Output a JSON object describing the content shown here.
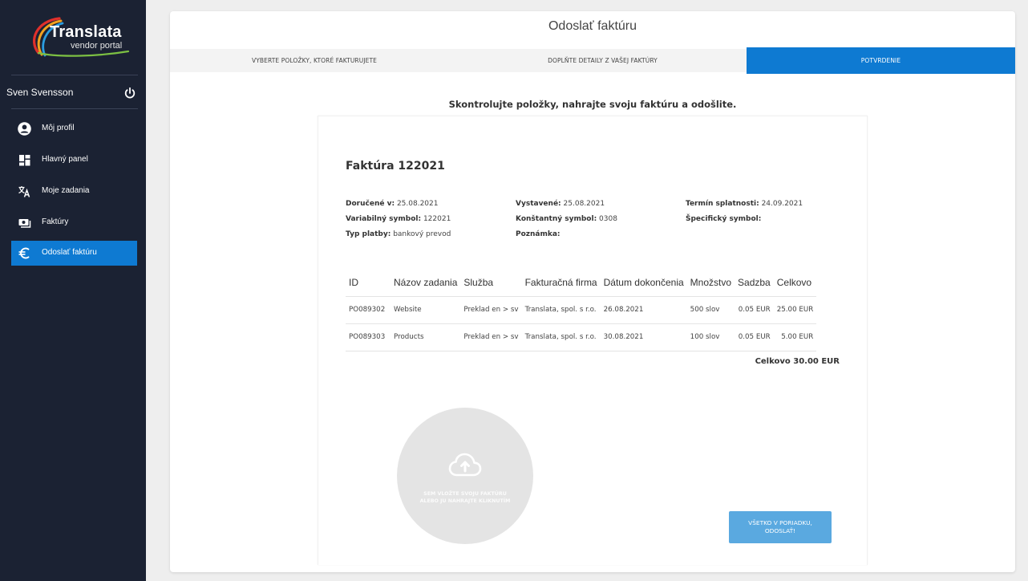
{
  "sidebar": {
    "logo": {
      "title": "Translata",
      "subtitle": "vendor portal"
    },
    "user": {
      "name": "Sven Svensson",
      "logout_icon": "power-icon"
    },
    "nav": [
      {
        "label": "Môj profil",
        "icon": "user-circle-icon",
        "active": false
      },
      {
        "label": "Hlavný panel",
        "icon": "dashboard-icon",
        "active": false
      },
      {
        "label": "Moje zadania",
        "icon": "translate-icon",
        "active": false
      },
      {
        "label": "Faktúry",
        "icon": "invoice-icon",
        "active": false
      },
      {
        "label": "Odoslať faktúru",
        "icon": "euro-icon",
        "active": true
      }
    ]
  },
  "page": {
    "title": "Odoslať faktúru",
    "steps": [
      {
        "label": "VYBERTE POLOŽKY, KTORÉ FAKTURUJETE",
        "active": false
      },
      {
        "label": "DOPLŇTE DETAILY Z VAŠEJ FAKTÚRY",
        "active": false
      },
      {
        "label": "POTVRDENIE",
        "active": true
      }
    ],
    "instruction": "Skontrolujte položky, nahrajte svoju faktúru a odošlite."
  },
  "invoice": {
    "title": "Faktúra 122021",
    "meta": {
      "received_label": "Doručené v:",
      "received": "25.08.2021",
      "issued_label": "Vystavené:",
      "issued": "25.08.2021",
      "due_label": "Termín splatnosti:",
      "due": "24.09.2021",
      "variable_label": "Variabilný symbol:",
      "variable": "122021",
      "constant_label": "Konštantný symbol:",
      "constant": "0308",
      "specific_label": "Špecifický symbol:",
      "specific": "",
      "payment_label": "Typ platby:",
      "payment": "bankový prevod",
      "note_label": "Poznámka:",
      "note": ""
    },
    "columns": [
      "ID",
      "Názov zadania",
      "Služba",
      "Fakturačná firma",
      "Dátum dokončenia",
      "Množstvo",
      "Sadzba",
      "Celkovo"
    ],
    "rows": [
      [
        "PO089302",
        "Website",
        "Preklad en > sv",
        "Translata, spol. s r.o.",
        "26.08.2021",
        "500 slov",
        "0.05 EUR",
        "25.00 EUR"
      ],
      [
        "PO089303",
        "Products",
        "Preklad en > sv",
        "Translata, spol. s r.o.",
        "30.08.2021",
        "100 slov",
        "0.05 EUR",
        "5.00 EUR"
      ]
    ],
    "total": "Celkovo 30.00 EUR"
  },
  "upload": {
    "icon": "cloud-upload-icon",
    "line1": "SEM VLOŽTE SVOJU FAKTÚRU",
    "line2": "ALEBO JU NAHRAJTE KLIKNUTÍM"
  },
  "confirm": {
    "line1": "VŠETKO V PORIADKU,",
    "line2": "ODOSLAŤ!"
  },
  "colors": {
    "sidebar_bg": "#1b2233",
    "accent": "#0e7ad2",
    "button": "#5aa9e0"
  }
}
